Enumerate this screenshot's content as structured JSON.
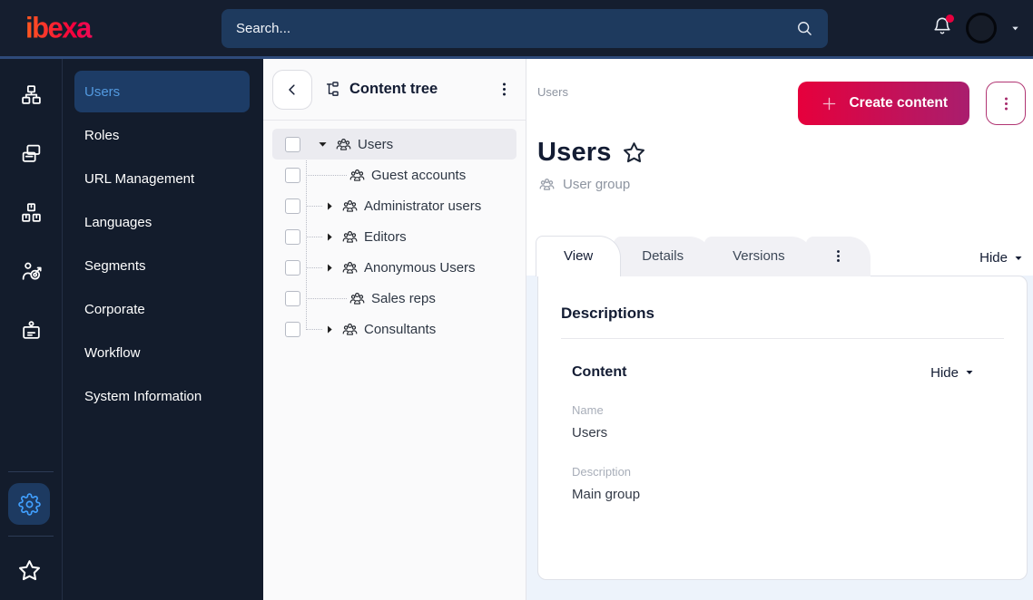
{
  "topbar": {
    "logo_text": "ibexa",
    "search_placeholder": "Search...",
    "notification_dot": true
  },
  "rail": {
    "items": [
      {
        "icon": "sitemap"
      },
      {
        "icon": "pages"
      },
      {
        "icon": "modules"
      },
      {
        "icon": "personalization"
      },
      {
        "icon": "id-badge"
      }
    ],
    "bottom": [
      {
        "icon": "gear",
        "active": true
      },
      {
        "icon": "star",
        "active": false
      }
    ]
  },
  "sidebar": {
    "items": [
      {
        "label": "Users",
        "selected": true
      },
      {
        "label": "Roles",
        "selected": false
      },
      {
        "label": "URL Management",
        "selected": false
      },
      {
        "label": "Languages",
        "selected": false
      },
      {
        "label": "Segments",
        "selected": false
      },
      {
        "label": "Corporate",
        "selected": false
      },
      {
        "label": "Workflow",
        "selected": false
      },
      {
        "label": "System Information",
        "selected": false
      }
    ]
  },
  "tree": {
    "title": "Content tree",
    "items": [
      {
        "label": "Users",
        "depth": 0,
        "caret": "expanded",
        "selected": true,
        "checked": false
      },
      {
        "label": "Guest accounts",
        "depth": 1,
        "caret": null,
        "selected": false,
        "checked": false
      },
      {
        "label": "Administrator users",
        "depth": 1,
        "caret": "collapsed",
        "selected": false,
        "checked": false
      },
      {
        "label": "Editors",
        "depth": 1,
        "caret": "collapsed",
        "selected": false,
        "checked": false
      },
      {
        "label": "Anonymous Users",
        "depth": 1,
        "caret": "collapsed",
        "selected": false,
        "checked": false
      },
      {
        "label": "Sales reps",
        "depth": 1,
        "caret": null,
        "selected": false,
        "checked": false
      },
      {
        "label": "Consultants",
        "depth": 1,
        "caret": "collapsed",
        "selected": false,
        "checked": false
      }
    ]
  },
  "main": {
    "breadcrumb": "Users",
    "create_button_label": "Create content",
    "page_title": "Users",
    "content_type": "User group",
    "tabs": [
      {
        "label": "View",
        "active": true
      },
      {
        "label": "Details",
        "active": false
      },
      {
        "label": "Versions",
        "active": false
      }
    ],
    "hide_toggle_label": "Hide",
    "card": {
      "descriptions_heading": "Descriptions",
      "content_heading": "Content",
      "content_hide_label": "Hide",
      "fields": [
        {
          "label": "Name",
          "value": "Users"
        },
        {
          "label": "Description",
          "value": "Main group"
        }
      ]
    }
  },
  "colors": {
    "topbar_bg": "#151e2f",
    "topbar_accent_line": "#2e4a7a",
    "sidebar_bg": "#131c2c",
    "selected_menu_bg": "#1d3c66",
    "selected_menu_text": "#539ae0",
    "brand_red": "#db0032",
    "button_gradient_start": "#e6003c",
    "button_gradient_end": "#a91e6e",
    "notification_dot": "#e8003f",
    "gear_icon_blue": "#41a0ff",
    "body_bg_blue": "#edf3fb"
  }
}
